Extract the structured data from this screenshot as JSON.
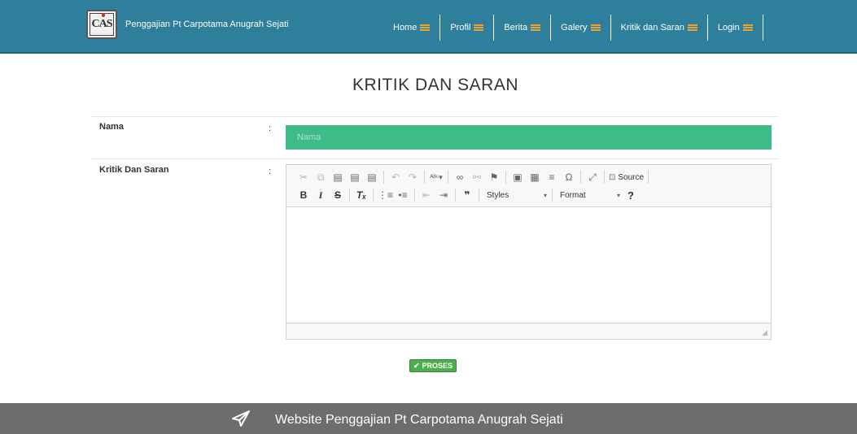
{
  "brand": {
    "logo_text": "CAS",
    "title": "Penggajian Pt Carpotama Anugrah Sejati"
  },
  "nav": {
    "items": [
      {
        "label": "Home"
      },
      {
        "label": "Profil"
      },
      {
        "label": "Berita"
      },
      {
        "label": "Galery"
      },
      {
        "label": "Kritik dan Saran"
      },
      {
        "label": "Login"
      }
    ],
    "menu_icon_color": "#f0a030"
  },
  "page": {
    "title": "KRITIK DAN SARAN"
  },
  "form": {
    "nama": {
      "label": "Nama",
      "colon": ":",
      "placeholder": "Nama",
      "value": ""
    },
    "kritik": {
      "label": "Kritik Dan Saran",
      "colon": ":",
      "value": ""
    },
    "submit_label": "PROSES"
  },
  "editor": {
    "toolbar_row1": [
      "cut-icon",
      "copy-icon",
      "paste-icon",
      "paste-text-icon",
      "paste-word-icon",
      "undo-icon",
      "redo-icon",
      "spellcheck-icon",
      "link-icon",
      "unlink-icon",
      "anchor-icon",
      "image-icon",
      "table-icon",
      "horizontal-line-icon",
      "special-char-icon",
      "maximize-icon",
      "source-icon"
    ],
    "source_label": "Source",
    "styles_label": "Styles",
    "format_label": "Format",
    "help_label": "?"
  },
  "footer": {
    "text": "Website Penggajian Pt Carpotama Anugrah Sejati"
  },
  "colors": {
    "navbar": "#2d7f9b",
    "input_green": "#3fbb89",
    "button_green": "#4cae4c",
    "footer": "#6d6d6d"
  }
}
